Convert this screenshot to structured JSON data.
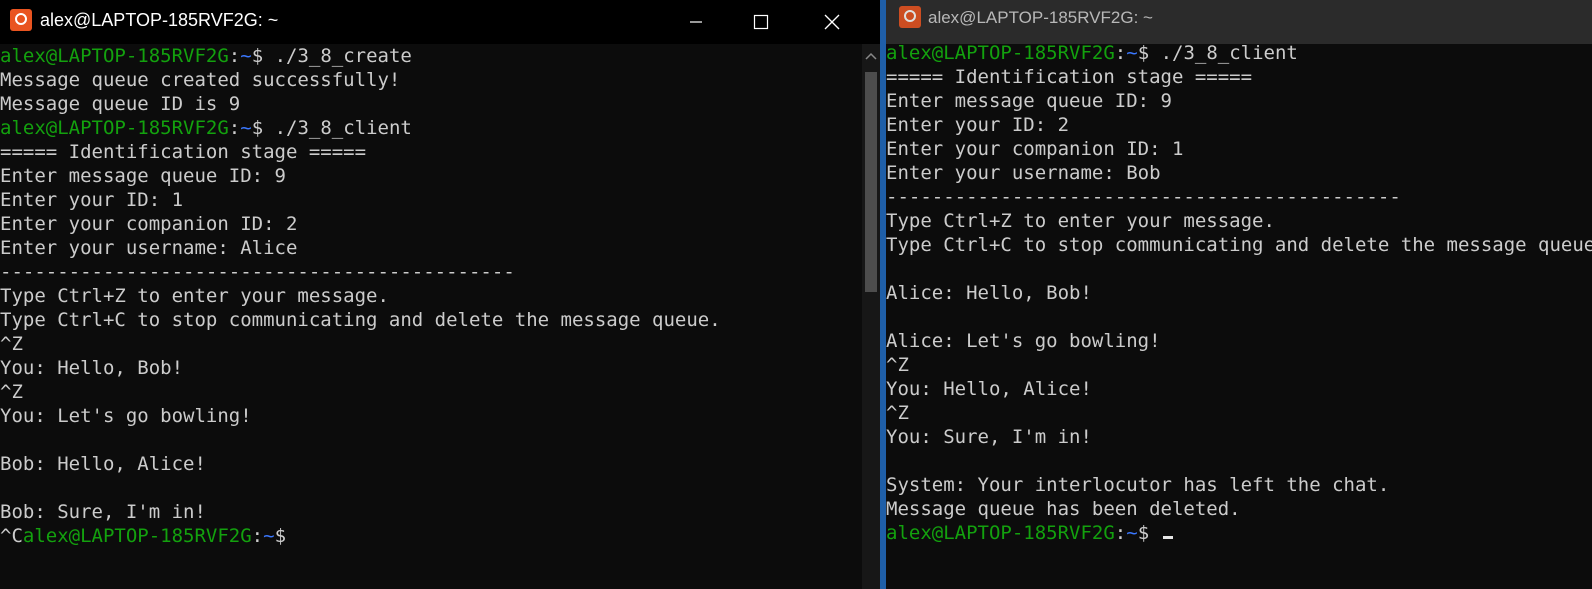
{
  "left_window": {
    "title": "alex@LAPTOP-185RVF2G: ~",
    "icons": {
      "app": "ubuntu-app-icon",
      "minimize": "minimize-icon",
      "maximize": "maximize-icon",
      "close": "close-icon",
      "scroll_up": "chevron-up-icon"
    },
    "lines": [
      {
        "user": "alex@LAPTOP-185RVF2G",
        "path": "~",
        "cmd": "$ ./3_8_create"
      },
      {
        "text": "Message queue created successfully!"
      },
      {
        "text": "Message queue ID is 9"
      },
      {
        "user": "alex@LAPTOP-185RVF2G",
        "path": "~",
        "cmd": "$ ./3_8_client"
      },
      {
        "text": "===== Identification stage ====="
      },
      {
        "text": "Enter message queue ID: 9"
      },
      {
        "text": "Enter your ID: 1"
      },
      {
        "text": "Enter your companion ID: 2"
      },
      {
        "text": "Enter your username: Alice"
      },
      {
        "text": "---------------------------------------------"
      },
      {
        "text": "Type Ctrl+Z to enter your message."
      },
      {
        "text": "Type Ctrl+C to stop communicating and delete the message queue."
      },
      {
        "text": "^Z"
      },
      {
        "text": "You: Hello, Bob!"
      },
      {
        "text": "^Z"
      },
      {
        "text": "You: Let's go bowling!"
      },
      {
        "text": ""
      },
      {
        "text": "Bob: Hello, Alice!"
      },
      {
        "text": ""
      },
      {
        "text": "Bob: Sure, I'm in!"
      },
      {
        "pre": "^C",
        "user": "alex@LAPTOP-185RVF2G",
        "path": "~",
        "cmd": "$"
      }
    ]
  },
  "right_window": {
    "title": "alex@LAPTOP-185RVF2G: ~",
    "icons": {
      "app": "ubuntu-app-icon"
    },
    "lines": [
      {
        "user": "alex@LAPTOP-185RVF2G",
        "path": "~",
        "cmd": "$ ./3_8_client"
      },
      {
        "text": "===== Identification stage ====="
      },
      {
        "text": "Enter message queue ID: 9"
      },
      {
        "text": "Enter your ID: 2"
      },
      {
        "text": "Enter your companion ID: 1"
      },
      {
        "text": "Enter your username: Bob"
      },
      {
        "text": "---------------------------------------------"
      },
      {
        "text": "Type Ctrl+Z to enter your message."
      },
      {
        "text": "Type Ctrl+C to stop communicating and delete the message queue."
      },
      {
        "text": ""
      },
      {
        "text": "Alice: Hello, Bob!"
      },
      {
        "text": ""
      },
      {
        "text": "Alice: Let's go bowling!"
      },
      {
        "text": "^Z"
      },
      {
        "text": "You: Hello, Alice!"
      },
      {
        "text": "^Z"
      },
      {
        "text": "You: Sure, I'm in!"
      },
      {
        "text": ""
      },
      {
        "text": "System: Your interlocutor has left the chat."
      },
      {
        "text": "Message queue has been deleted."
      },
      {
        "user": "alex@LAPTOP-185RVF2G",
        "path": "~",
        "cmd": "$ ",
        "cursor": true
      }
    ]
  },
  "colors": {
    "background": "#0c0c0c",
    "prompt_user": "#13a10e",
    "prompt_path": "#3b78ff",
    "text": "#cccccc",
    "divider": "#1f5fa8"
  }
}
